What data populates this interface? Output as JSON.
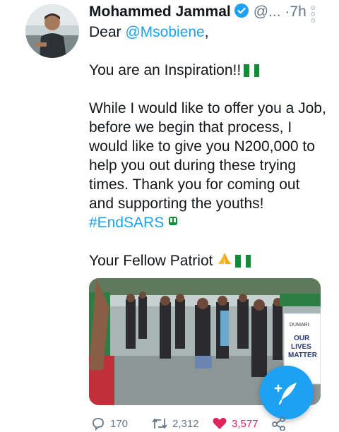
{
  "tweet": {
    "author_name": "Mohammed Jammal",
    "handle": "@...",
    "separator": "·",
    "time": "7h",
    "line_dear": "Dear ",
    "mention": "@Msobiene",
    "line_dear_end": ",",
    "line_inspiration": "You are an Inspiration!!",
    "para_offer": [
      "While I would like to offer you a Job,",
      "before we begin that process, I",
      "would like to give you N200,000 to",
      "help you out during these trying",
      "times. Thank you for coming out",
      "and supporting the youths!"
    ],
    "hashtag": "#EndSARS",
    "signoff": "Your Fellow Patriot",
    "sign_text": [
      "DUMARI",
      "OUR",
      "LIVES",
      "MATTER"
    ]
  },
  "actions": {
    "reply_count": "170",
    "retweet_count": "2,312",
    "like_count": "3,577"
  },
  "icons": {
    "verified": "verified-badge-icon",
    "more": "more-vertical-icon",
    "reply": "reply-icon",
    "retweet": "retweet-icon",
    "like": "heart-icon",
    "share": "share-icon",
    "compose": "compose-tweet-icon"
  },
  "colors": {
    "accent": "#1da1f2",
    "like": "#e0245e",
    "nigeria_green": "#138a36"
  }
}
